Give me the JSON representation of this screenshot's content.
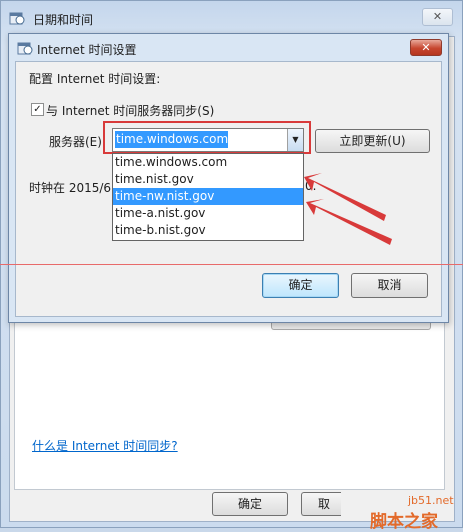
{
  "outer_window": {
    "title": "日期和时间",
    "close_glyph": "✕",
    "link": "什么是 Internet 时间同步?",
    "ok_label": "确定",
    "cancel_label": "取消"
  },
  "dialog": {
    "title": "Internet 时间设置",
    "close_glyph": "✕",
    "config_label": "配置 Internet 时间设置:",
    "sync_checked_glyph": "✓",
    "sync_label": "与 Internet 时间服务器同步(S)",
    "server_label": "服务器(E):",
    "server_value": "time.windows.com",
    "dropdown_arrow": "▼",
    "update_button": "立即更新(U)",
    "clock_text_start": "时钟在 2015/6",
    "clock_text_end": "0.",
    "server_options": [
      "time.windows.com",
      "time.nist.gov",
      "time-nw.nist.gov",
      "time-a.nist.gov",
      "time-b.nist.gov"
    ],
    "selected_option_index": 2,
    "ok_label": "确定",
    "cancel_label": "取消"
  },
  "watermark": {
    "url": "jb51.net",
    "name": "脚本之家"
  },
  "colors": {
    "selection": "#3399ff",
    "annotation_red": "#d83a3a",
    "link_blue": "#0066cc"
  },
  "icons": [
    "calendar-clock-icon",
    "close-icon",
    "checkbox-checked-icon",
    "dropdown-arrow-icon"
  ]
}
